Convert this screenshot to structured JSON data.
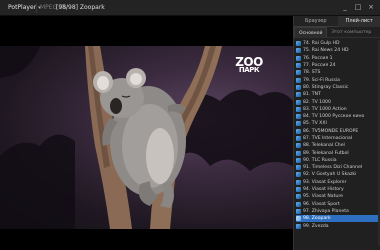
{
  "titlebar": {
    "app_label": "PotPlayer",
    "format": "MPEG TS",
    "title": "[98/98] Zoopark",
    "controls": [
      "_",
      "□",
      "×"
    ]
  },
  "video": {
    "logo_line1": "ZOO",
    "logo_line2": "ПАРК"
  },
  "panel": {
    "tabs": [
      "Браузер",
      "Плей-лист"
    ],
    "active_tab": "Плей-лист",
    "subtabs": [
      "Основной",
      "Этот компьютер"
    ],
    "active_subtab": "Основной",
    "items": [
      "74. Rai Gulp HD",
      "75. Rai News 24 HD",
      "76. Россия 1",
      "77. Россия 24",
      "78. STS",
      "79. Sci-Fi Russia",
      "80. Stingray Classic",
      "81. TNT",
      "82. TV 1000",
      "83. TV 1000 Action",
      "84. TV 1000 Русское кино",
      "85. TV XXI",
      "86. TV5MONDE EUROPE",
      "87. TVE Internacional",
      "88. Telekanal Chel",
      "89. Telekanal Futbol",
      "90. TLC Russia",
      "91. Timeless Dizi Channel",
      "92. V Gostyah U Skazki",
      "93. Viasat Explorer",
      "94. Viasat History",
      "95. Viasat Nature",
      "96. Viasat Sport",
      "97. Zhivaya Planeta",
      "98. Zoopark",
      "99. Zvezda"
    ],
    "selected_index": 24
  },
  "colors": {
    "selection": "#2f6fc1",
    "background": "#1a1a1a"
  }
}
